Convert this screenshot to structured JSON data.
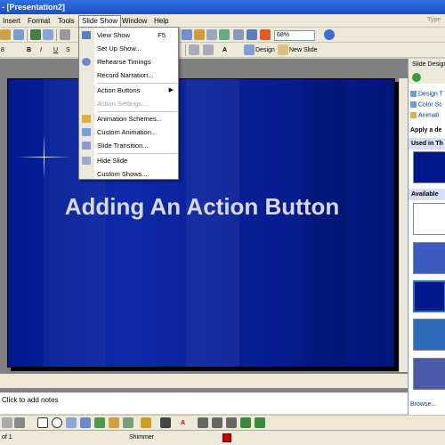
{
  "window": {
    "title": "- [Presentation2]"
  },
  "menubar": {
    "items": [
      "Insert",
      "Format",
      "Tools",
      "Slide Show",
      "Window",
      "Help"
    ],
    "type_help": "Type"
  },
  "toolbar": {
    "zoom": "68%",
    "design_label": "Design",
    "new_slide_label": "New Slide",
    "font_size": "8"
  },
  "slide_show_menu": {
    "items": [
      {
        "label": "View Show",
        "shortcut": "F5",
        "icon": "projector-icon"
      },
      {
        "label": "Set Up Show...",
        "icon": ""
      },
      {
        "label": "Rehearse Timings",
        "icon": "stopwatch-icon"
      },
      {
        "label": "Record Narration...",
        "icon": ""
      },
      {
        "label": "Action Buttons",
        "submenu": true,
        "icon": ""
      },
      {
        "label": "Action Settings...",
        "disabled": true,
        "icon": ""
      },
      {
        "label": "Animation Schemes...",
        "icon": "star-icon"
      },
      {
        "label": "Custom Animation...",
        "icon": "animation-icon"
      },
      {
        "label": "Slide Transition...",
        "icon": "transition-icon"
      },
      {
        "label": "Hide Slide",
        "icon": "hide-slide-icon"
      },
      {
        "label": "Custom Shows...",
        "icon": ""
      }
    ]
  },
  "slide": {
    "title": "Adding An Action Button"
  },
  "notes": {
    "placeholder": "Click to add notes"
  },
  "task_pane": {
    "title": "Slide Design",
    "links": [
      "Design T",
      "Color Sc",
      "Animati"
    ],
    "apply_heading": "Apply a de",
    "used_heading": "Used in Th",
    "available_heading": "Available",
    "browse": "Browse..."
  },
  "status": {
    "slide_info": "of 1",
    "design": "Shimmer"
  },
  "colors": {
    "slide_bg": "#00188c",
    "title_text": "#d9d9e8",
    "menu_highlight": "#316ac5"
  }
}
